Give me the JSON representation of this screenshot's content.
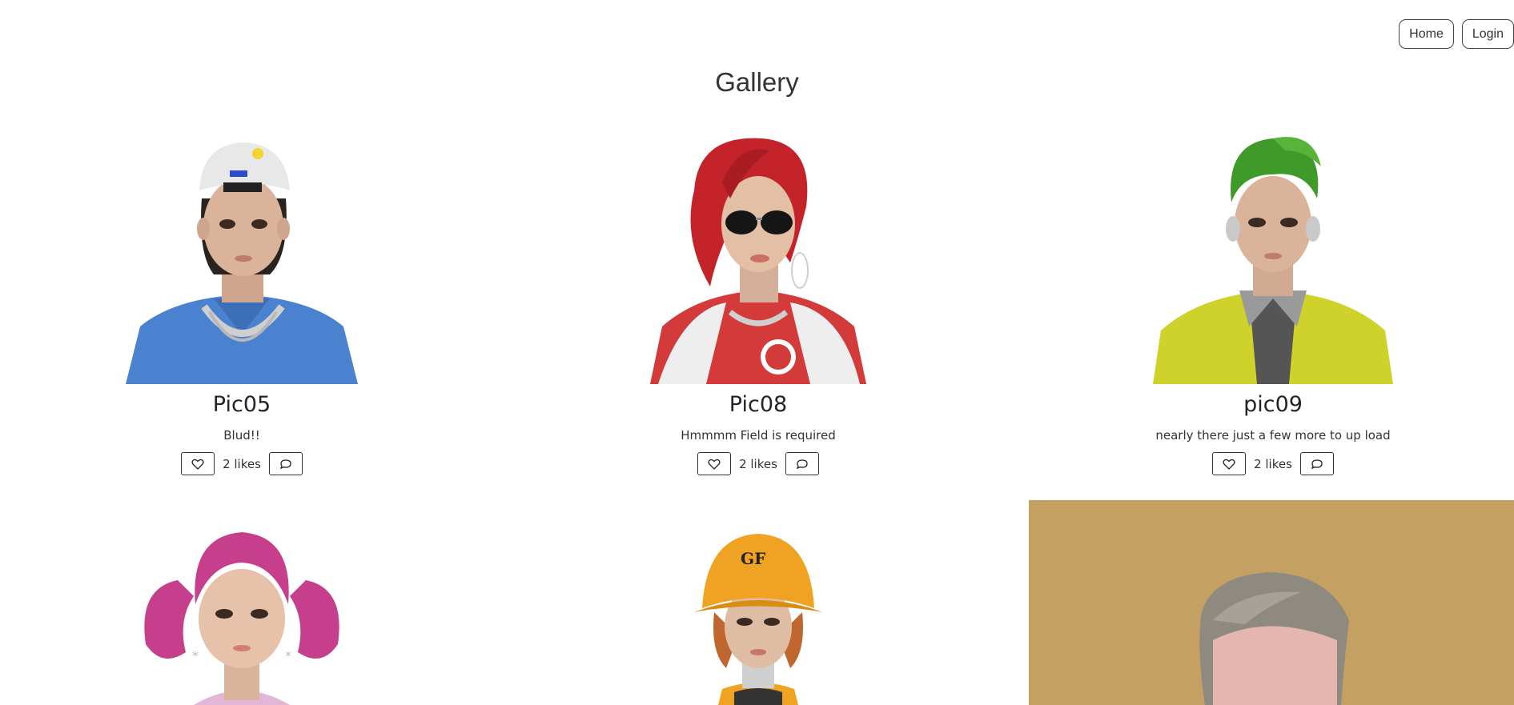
{
  "nav": {
    "home_label": "Home",
    "login_label": "Login"
  },
  "page": {
    "title": "Gallery"
  },
  "cards": [
    {
      "name": "Pic05",
      "caption": "Blud!!",
      "likes_text": "2 likes",
      "likes": 2,
      "image_alt": "avatar with white cap and blue polo",
      "colors": {
        "hair": "#2a2320",
        "skin": "#d9b49b",
        "cap": "#e6e6e6",
        "shirt": "#4a82d0",
        "chain": "#c9c9c9"
      }
    },
    {
      "name": "Pic08",
      "caption": "Hmmmm Field is required",
      "likes_text": "2 likes",
      "likes": 2,
      "image_alt": "avatar with red hair and sunglasses",
      "colors": {
        "hair": "#c4232a",
        "skin": "#e3bfa6",
        "jacket": "#d33b3b",
        "collar": "#eeeeee"
      }
    },
    {
      "name": "pic09",
      "caption": "nearly there just a few more to up load",
      "likes_text": "2 likes",
      "likes": 2,
      "image_alt": "avatar with green hair and yellow vest",
      "colors": {
        "hair": "#3f9a2a",
        "skin": "#d9b49b",
        "vest": "#cfd22a",
        "inner": "#555555"
      }
    },
    {
      "image_alt": "avatar with pink pigtails",
      "colors": {
        "hair": "#c63f8c",
        "skin": "#e6c2aa",
        "top": "#e2b6d6"
      }
    },
    {
      "image_alt": "avatar with orange bucket hat",
      "colors": {
        "hat": "#f0a322",
        "skin": "#dfbda5",
        "hair": "#c0662f"
      }
    },
    {
      "image_alt": "avatar with grey hair on tan background",
      "colors": {
        "bg": "#c4a063",
        "hair": "#8f8a80",
        "skin": "#e5b6b0"
      }
    }
  ],
  "icons": {
    "like": "heart-icon",
    "comment": "comment-icon"
  }
}
